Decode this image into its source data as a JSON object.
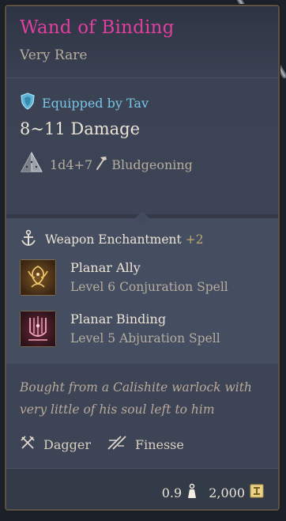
{
  "item": {
    "name": "Wand of Binding",
    "rarity": "Very Rare",
    "name_color": "#e13fa0"
  },
  "equipped": {
    "label": "Equipped by Tav",
    "icon": "shield-icon"
  },
  "damage": {
    "range": "8~11 Damage",
    "dice": "1d4+7",
    "dice_icon": "d4-die-icon",
    "type": "Bludgeoning",
    "type_icon": "hammer-icon"
  },
  "enchantment": {
    "label": "Weapon Enchantment",
    "bonus": "+2",
    "icon": "enchantment-icon"
  },
  "spells": [
    {
      "name": "Planar Ally",
      "level": "Level 6 Conjuration Spell",
      "icon": "planar-ally-spell-icon"
    },
    {
      "name": "Planar Binding",
      "level": "Level 5 Abjuration Spell",
      "icon": "planar-binding-spell-icon"
    }
  ],
  "description": "Bought from a Calishite warlock with very little of his soul left to him",
  "properties": [
    {
      "label": "Dagger",
      "icon": "dagger-icon"
    },
    {
      "label": "Finesse",
      "icon": "finesse-icon"
    }
  ],
  "footer": {
    "weight": "0.9",
    "weight_icon": "weight-icon",
    "price": "2,000",
    "price_icon": "gold-coin-icon"
  }
}
